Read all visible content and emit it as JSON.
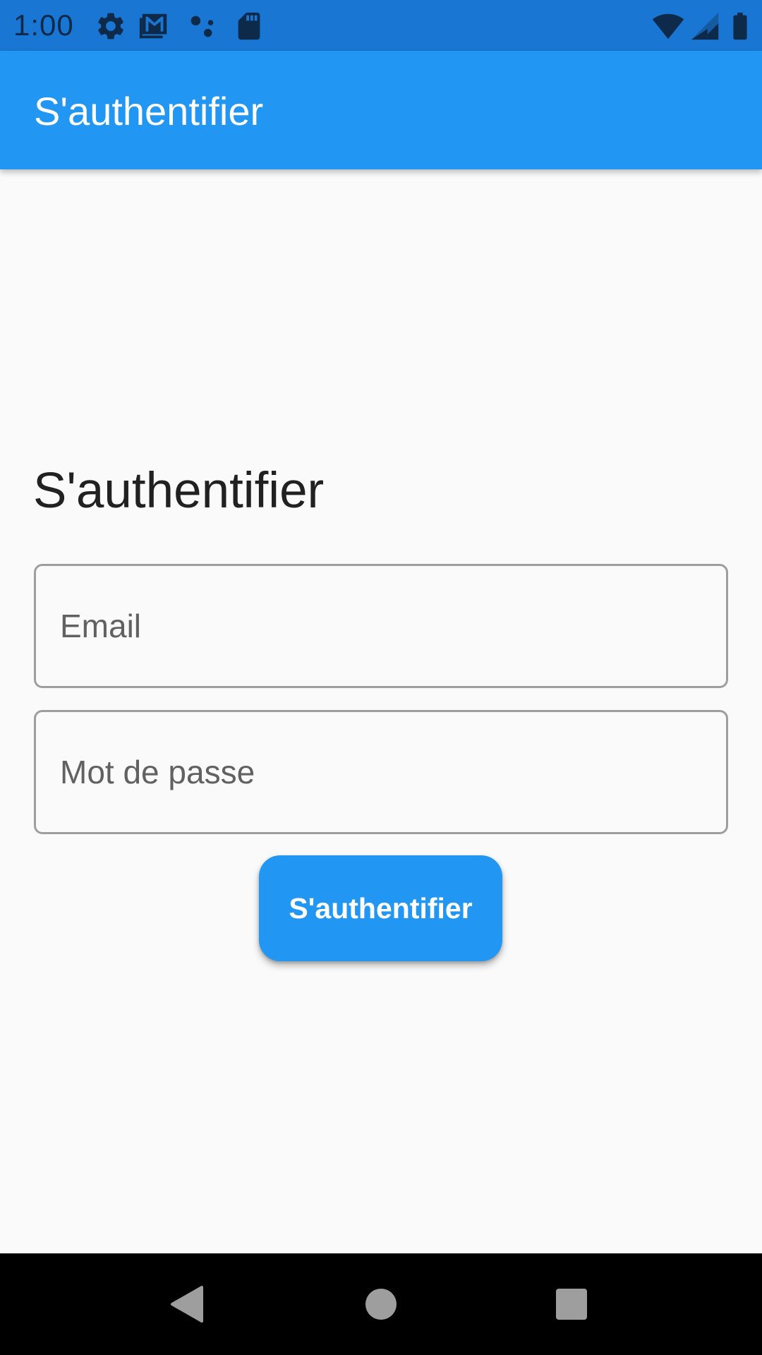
{
  "status_bar": {
    "time": "1:00",
    "background_color": "#1976D2",
    "icons_left": [
      "settings-icon",
      "gmail-icon",
      "assistant-dots-icon",
      "sd-card-icon"
    ],
    "icons_right": [
      "wifi-icon",
      "cellular-signal-icon",
      "battery-icon"
    ]
  },
  "app_bar": {
    "title": "S'authentifier",
    "background_color": "#2196F3"
  },
  "form": {
    "heading": "S'authentifier",
    "email_label": "Email",
    "password_label": "Mot de passe",
    "submit_label": "S'authentifier",
    "button_color": "#2196F3"
  },
  "nav_bar": {
    "buttons": [
      "back-icon",
      "home-icon",
      "recents-icon"
    ]
  }
}
